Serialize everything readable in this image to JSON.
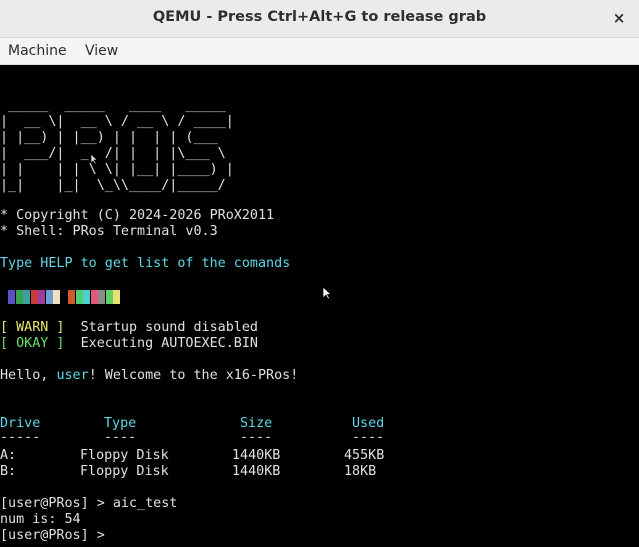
{
  "window": {
    "title": "QEMU - Press Ctrl+Alt+G to release grab",
    "close_glyph": "×"
  },
  "menu": {
    "items": [
      "Machine",
      "View"
    ]
  },
  "terminal": {
    "logo": [
      " _____  _____   ____   _____ ",
      "|  __ \\|  __ \\ / __ \\ / ____|",
      "| |__) | |__) | |  | | (___  ",
      "|  ___/|  _  /| |  | |\\___ \\ ",
      "| |    | | \\ \\| |__| |____) |",
      "|_|    |_|  \\_\\\\____/|_____/ "
    ],
    "copyright": "* Copyright (C) 2024-2026 PRoX2011",
    "shell": "* Shell: PRos Terminal v0.3",
    "help_hint": "Type HELP to get list of the comands",
    "palette_colors": [
      "#5a4fc8",
      "#3aa050",
      "#3aa0a0",
      "#c83c3c",
      "#a03ca0",
      "#6b9fd0",
      "#f0e0c0",
      "#000000",
      "#d05a2a",
      "#4fd070",
      "#4fd0d0",
      "#e05a7a",
      "#8a8a8a",
      "#60d060",
      "#e8e070"
    ],
    "warn_tag": "[ WARN ]",
    "warn_msg": "Startup sound disabled",
    "okay_tag": "[ OKAY ]",
    "okay_msg": "Executing AUTOEXEC.BIN",
    "hello_prefix": "Hello, ",
    "hello_user": "user",
    "hello_suffix": "! Welcome to the x16-PRos!",
    "table": {
      "headers": [
        "Drive",
        "Type",
        "Size",
        "Used"
      ],
      "separators": [
        "-----",
        "----",
        "----",
        "----"
      ],
      "rows": [
        [
          "A:",
          "Floppy Disk",
          "1440KB",
          "455KB"
        ],
        [
          "B:",
          "Floppy Disk",
          "1440KB",
          "18KB"
        ]
      ]
    },
    "prompt1": "[user@PRos] > aic_test",
    "output1": "num is: 54",
    "prompt2": "[user@PRos] > "
  }
}
